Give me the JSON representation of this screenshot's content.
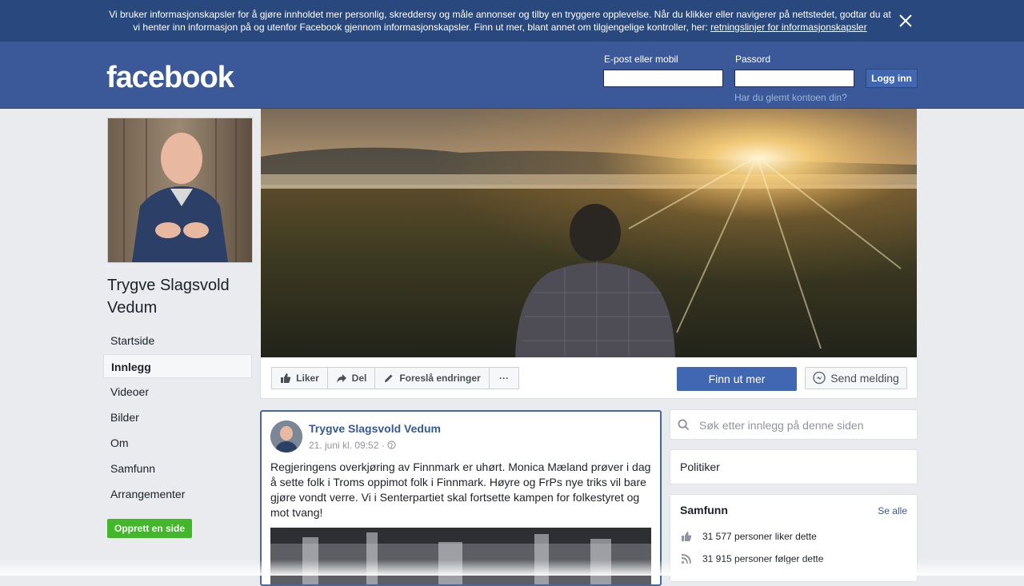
{
  "cookie_banner": {
    "text_line1": "Vi bruker informasjonskapsler for å gjøre innholdet mer personlig, skreddersy og måle annonser og tilby en tryggere opplevelse. Når du klikker eller navigerer på nettstedet, godtar du at",
    "text_line2": "vi henter inn informasjon på og utenfor Facebook gjennom informasjonskapsler. Finn ut mer, blant annet om tilgjengelige kontroller, her:",
    "link": "retningslinjer for informasjonskapsler"
  },
  "header": {
    "logo": "facebook",
    "email_label": "E-post eller mobil",
    "password_label": "Passord",
    "login_button": "Logg inn",
    "forgot_link": "Har du glemt kontoen din?"
  },
  "profile": {
    "name": "Trygve Slagsvold Vedum"
  },
  "nav": {
    "items": [
      {
        "label": "Startside"
      },
      {
        "label": "Innlegg"
      },
      {
        "label": "Videoer"
      },
      {
        "label": "Bilder"
      },
      {
        "label": "Om"
      },
      {
        "label": "Samfunn"
      },
      {
        "label": "Arrangementer"
      }
    ],
    "active": "Innlegg",
    "create_page": "Opprett en side"
  },
  "actions": {
    "like": "Liker",
    "share": "Del",
    "suggest": "Foreslå endringer",
    "more": "···",
    "learn_more": "Finn ut mer",
    "send_message": "Send melding"
  },
  "post": {
    "author": "Trygve Slagsvold Vedum",
    "time": "21. juni kl. 09:52 ·",
    "text": "Regjeringens overkjøring av Finnmark er uhørt. Monica Mæland prøver i dag å sette folk i Troms oppimot folk i Finnmark. Høyre og FrPs nye triks vil bare gjøre vondt verre. Vi i Senterpartiet skal fortsette kampen for folkestyret og mot tvang!"
  },
  "sidebar": {
    "search_placeholder": "Søk etter innlegg på denne siden",
    "category": "Politiker",
    "community_title": "Samfunn",
    "see_all": "Se alle",
    "likes_text": "31 577 personer liker dette",
    "follows_text": "31 915 personer følger dette"
  },
  "colors": {
    "brand_blue": "#3b5998",
    "banner_blue": "#29487d",
    "button_blue": "#4267b2",
    "green": "#42b72a"
  }
}
